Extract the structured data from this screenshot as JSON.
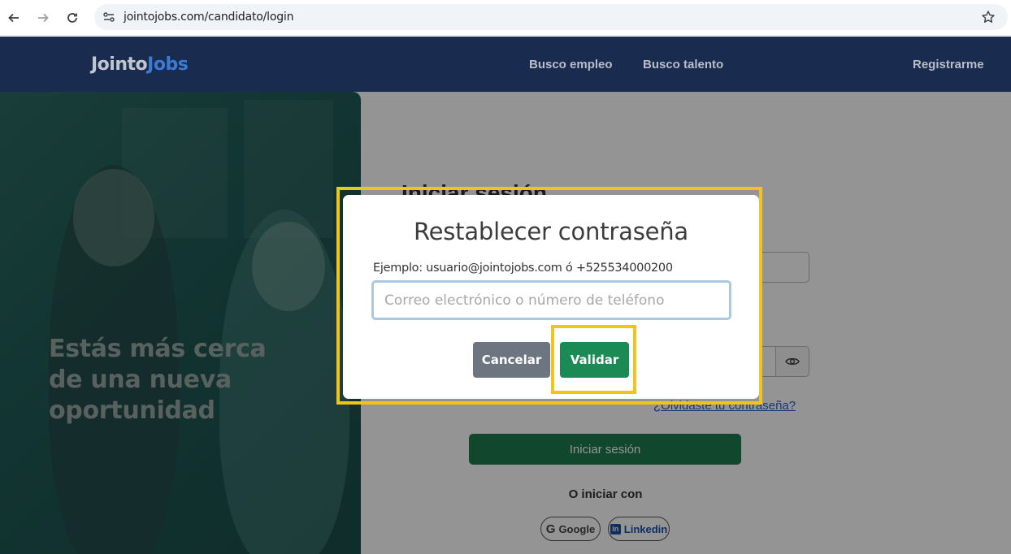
{
  "browser": {
    "url": "jointojobs.com/candidato/login"
  },
  "header": {
    "logo_part1": "Jointo",
    "logo_part2": "Jobs",
    "nav_items": [
      "Busco empleo",
      "Busco talento"
    ],
    "register_label": "Registrarme"
  },
  "hero": {
    "line1": "Estás más cerca",
    "line2": "de una nueva",
    "line3": "oportunidad"
  },
  "login": {
    "title": "Iniciar sesión",
    "forgot_password": "¿Olvidaste tu contraseña?",
    "submit_label": "Iniciar sesión",
    "or_text": "O iniciar con",
    "google_label": "Google",
    "linkedin_label": "Linkedin"
  },
  "modal": {
    "title": "Restablecer contraseña",
    "hint": "Ejemplo: usuario@jointojobs.com ó +525534000200",
    "input_value": "",
    "input_placeholder": "Correo electrónico o número de teléfono",
    "cancel_label": "Cancelar",
    "validate_label": "Validar"
  },
  "colors": {
    "header_bg": "#1a2b50",
    "primary_green": "#1c8a55",
    "highlight": "#f2c41a"
  }
}
